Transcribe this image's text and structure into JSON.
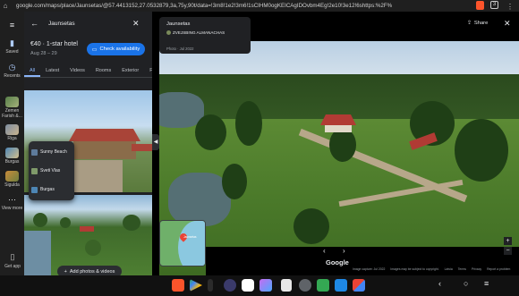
{
  "browser": {
    "url": "google.com/maps/place/Jaunsetas/@57.4413152,27.0532879,3a,75y,90t/data=!3m8!1e2!3m6!1sCIHM0ogKEICAgIDOvbm4Eg!2e10!3e12!6shttps:%2F%2Flh3.googl",
    "tab_count": "3"
  },
  "rail": {
    "items": [
      {
        "label": "Saved",
        "icon": "bookmark-icon"
      },
      {
        "label": "Recents",
        "icon": "history-icon"
      },
      {
        "label": "Zemen Farish &...",
        "icon": "place-thumb"
      },
      {
        "label": "Riga",
        "icon": "place-thumb"
      },
      {
        "label": "Burgas",
        "icon": "place-thumb"
      },
      {
        "label": "Sigulda",
        "icon": "place-thumb"
      },
      {
        "label": "View more",
        "icon": "more-icon"
      }
    ],
    "get_app": "Get app"
  },
  "panel": {
    "search_query": "Jaunsetas",
    "price": "€40 · 1-star hotel",
    "dates": "Aug 28 – 29",
    "check_button": "Check availability",
    "tabs": [
      "All",
      "Latest",
      "Videos",
      "Rooms",
      "Exterior",
      "Food"
    ],
    "active_tab": "All",
    "menu_items": [
      "Sunny Beach",
      "Sveti Vlas",
      "Burgas"
    ],
    "add_photos": "Add photos & videos"
  },
  "streetview": {
    "place_title": "Jaunsetas",
    "contributor": "ZVEJSBING ALMANACHAS",
    "photo_date": "Photo · Jul 2022",
    "share": "Share",
    "minimap_label": "Jaunsetas",
    "logo": "Google",
    "footer": [
      "Image capture: Jul 2022",
      "Images may be subject to copyright.",
      "Latvia",
      "Terms",
      "Privacy",
      "Report a problem"
    ]
  },
  "colors": {
    "accent": "#1a73e8",
    "panel_bg": "#202124",
    "active_tab": "#8ab4f8"
  }
}
